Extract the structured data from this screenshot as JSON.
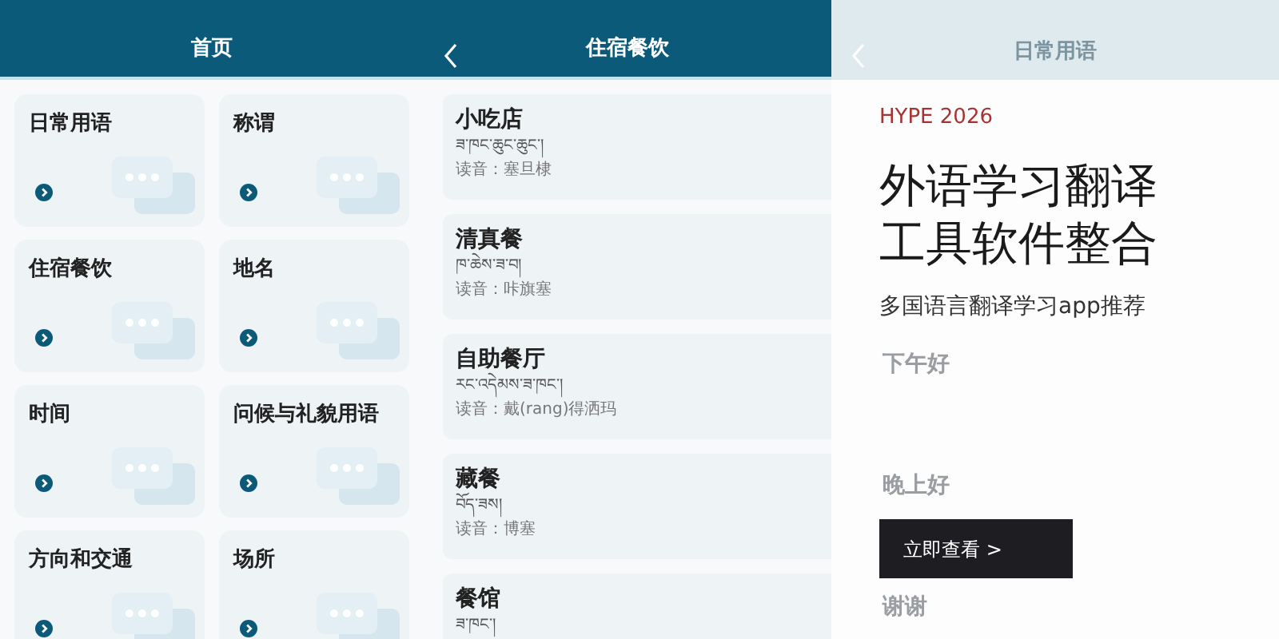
{
  "home": {
    "title": "首页",
    "categories": [
      {
        "label": "日常用语"
      },
      {
        "label": "称谓"
      },
      {
        "label": "住宿餐饮"
      },
      {
        "label": "地名"
      },
      {
        "label": "时间"
      },
      {
        "label": "问候与礼貌用语"
      },
      {
        "label": "方向和交通"
      },
      {
        "label": "场所"
      }
    ]
  },
  "lodging": {
    "title": "住宿餐饮",
    "phrases": [
      {
        "chinese": "小吃店",
        "tibetan": "ཟ་ཁང་ཆུང་ཆུང་།",
        "reading": "读音：塞旦棣"
      },
      {
        "chinese": "清真餐",
        "tibetan": "ཁ་ཆེས་ཟ་བ།",
        "reading": "读音：咔旗塞"
      },
      {
        "chinese": "自助餐厅",
        "tibetan": "རང་འདེམས་ཟ་ཁང་།",
        "reading": "读音：戴(rang)得洒玛"
      },
      {
        "chinese": "藏餐",
        "tibetan": "བོད་ཟས།",
        "reading": "读音：博塞"
      },
      {
        "chinese": "餐馆",
        "tibetan": "ཟ་ཁང་།"
      }
    ]
  },
  "daily": {
    "title": "日常用语",
    "phrases": [
      {
        "chinese": "下午好"
      },
      {
        "chinese": "晚上好"
      },
      {
        "chinese": "谢谢"
      }
    ]
  },
  "promo": {
    "tag": "HYPE 2026",
    "headline_lines": [
      "外语学习翻译",
      "工具软件整合"
    ],
    "subtitle": "多国语言翻译学习app推荐",
    "button": "立即查看 >"
  }
}
